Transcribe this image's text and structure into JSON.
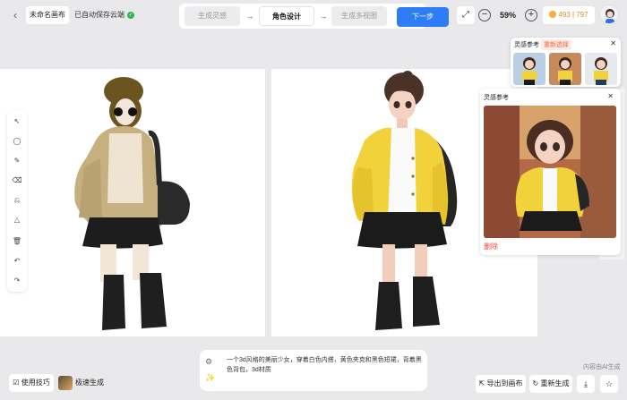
{
  "header": {
    "title": "未命名画布",
    "save_status": "已自动保存云端",
    "steps": [
      "生成灵感",
      "角色设计",
      "生成多视图"
    ],
    "next": "下一步",
    "zoom": "59%",
    "credits": "493 | 797"
  },
  "references": {
    "panel_title": "灵感参考",
    "regenerate": "重新选择",
    "card_title": "灵感参考",
    "delete": "删除"
  },
  "prompt": {
    "text": "一个3d风格的美丽少女，穿着白色内搭，黄色夹克和黑色短裙，背着黑色背包，3d材质"
  },
  "footer": {
    "tips": "使用技巧",
    "fast": "极速生成",
    "ai_note": "内容由AI生成",
    "export": "导出到画布",
    "regenerate": "重新生成"
  },
  "icons": {
    "back": "chevron-left-icon",
    "expand": "expand-icon",
    "zoom_out": "minus-icon",
    "zoom_in": "plus-icon",
    "download": "download-icon",
    "star": "star-icon"
  },
  "colors": {
    "primary": "#2f7df6",
    "danger": "#e84a3a",
    "accent": "#f06a3b",
    "jacket": "#f2d23a"
  }
}
